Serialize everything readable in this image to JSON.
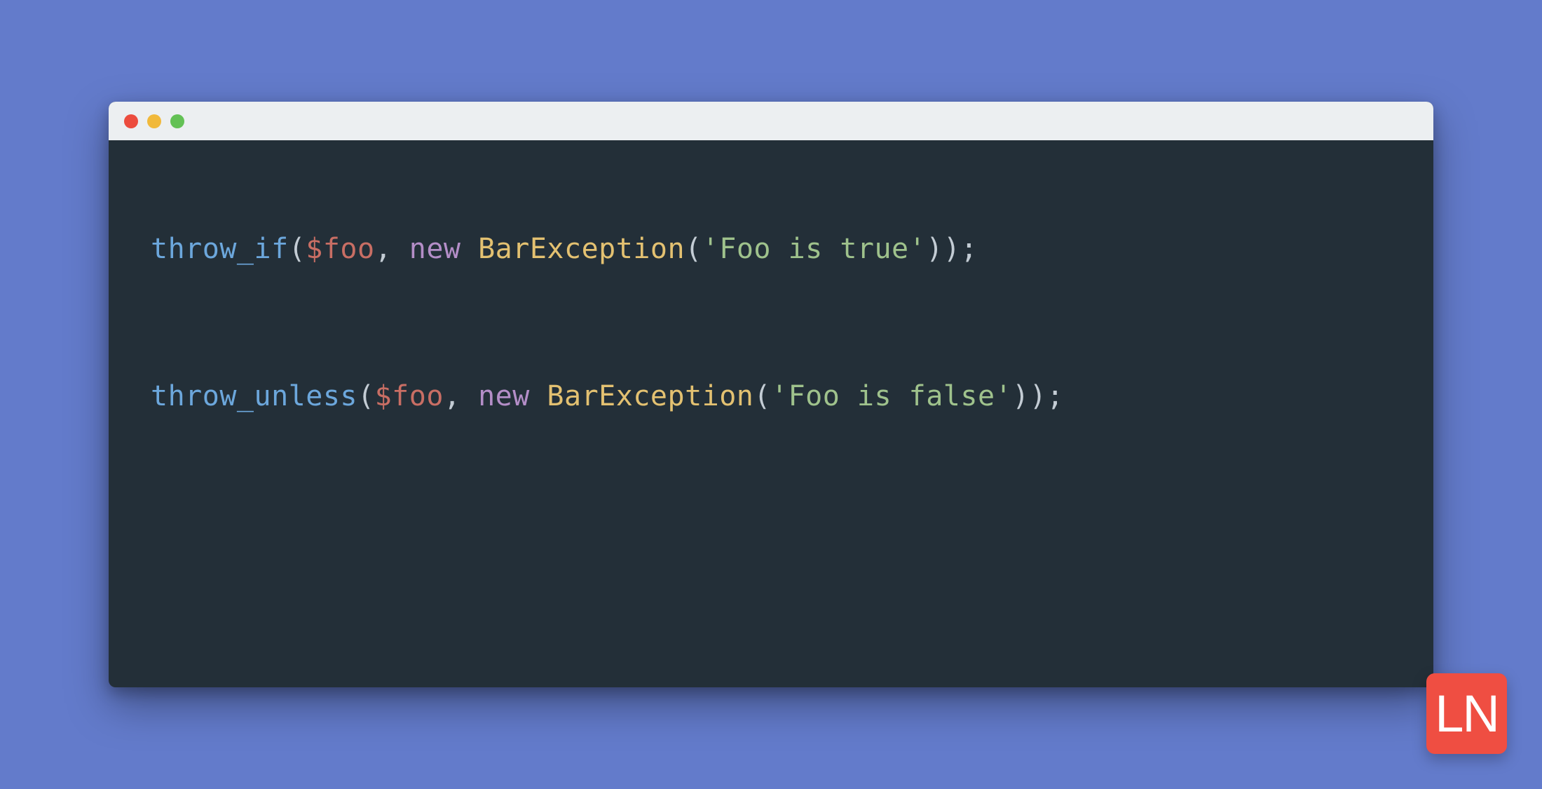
{
  "colors": {
    "background": "#637BCB",
    "editor_bg": "#232F38",
    "titlebar_bg": "#ECEFF1",
    "traffic_red": "#EC4C3E",
    "traffic_yellow": "#F1B93B",
    "traffic_green": "#63C155",
    "token_function": "#6CA7DC",
    "token_punct": "#C3CCD4",
    "token_variable": "#C86E64",
    "token_keyword": "#B48EC8",
    "token_class": "#E3C171",
    "token_string": "#9FC28C",
    "logo_bg": "#EF4E42",
    "logo_fg": "#FFFFFF"
  },
  "code": {
    "lines": [
      {
        "tokens": {
          "func": "throw_if",
          "open": "(",
          "var": "$foo",
          "comma": ", ",
          "keyword": "new ",
          "class": "BarException",
          "open2": "(",
          "string": "'Foo is true'",
          "close": "));"
        }
      },
      {
        "tokens": {
          "func": "throw_unless",
          "open": "(",
          "var": "$foo",
          "comma": ", ",
          "keyword": "new ",
          "class": "BarException",
          "open2": "(",
          "string": "'Foo is false'",
          "close": "));"
        }
      }
    ]
  },
  "logo": {
    "text": "LN"
  }
}
